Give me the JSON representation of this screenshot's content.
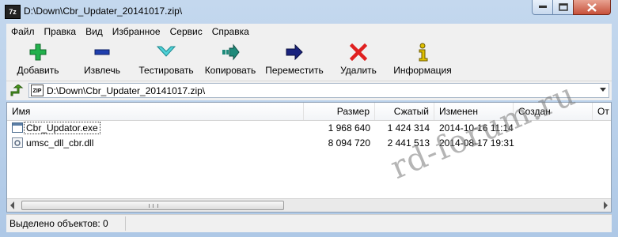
{
  "window": {
    "title": "D:\\Down\\Cbr_Updater_20141017.zip\\",
    "icon_text": "7z",
    "minimize_icon": "minimize-icon",
    "maximize_icon": "maximize-icon",
    "close_icon": "close-icon"
  },
  "menubar": {
    "items": [
      {
        "label": "Файл"
      },
      {
        "label": "Правка"
      },
      {
        "label": "Вид"
      },
      {
        "label": "Избранное"
      },
      {
        "label": "Сервис"
      },
      {
        "label": "Справка"
      }
    ]
  },
  "toolbar": {
    "buttons": [
      {
        "label": "Добавить",
        "icon": "plus-icon",
        "color": "#22b14c"
      },
      {
        "label": "Извлечь",
        "icon": "minus-icon",
        "color": "#1f3fae"
      },
      {
        "label": "Тестировать",
        "icon": "check-arrow-icon",
        "color": "#4fd0d6"
      },
      {
        "label": "Копировать",
        "icon": "copy-arrow-icon",
        "color": "#1e8a7a"
      },
      {
        "label": "Переместить",
        "icon": "move-arrow-icon",
        "color": "#1a237e"
      },
      {
        "label": "Удалить",
        "icon": "delete-x-icon",
        "color": "#e02020"
      },
      {
        "label": "Информация",
        "icon": "info-icon",
        "color": "#e0c000"
      }
    ]
  },
  "address": {
    "path": "D:\\Down\\Cbr_Updater_20141017.zip\\",
    "zip_icon_text": "ZIP"
  },
  "list": {
    "columns": [
      "Имя",
      "Размер",
      "Сжатый",
      "Изменен",
      "Создан",
      "От"
    ],
    "rows": [
      {
        "name": "Cbr_Updator.exe",
        "size": "1 968 640",
        "packed": "1 424 314",
        "modified": "2014-10-16 11:14",
        "created": "",
        "icon": "exe-file-icon"
      },
      {
        "name": "umsc_dll_cbr.dll",
        "size": "8 094 720",
        "packed": "2 441 513",
        "modified": "2014-08-17 19:31",
        "created": "",
        "icon": "dll-file-icon"
      }
    ]
  },
  "status": {
    "text": "Выделено объектов: 0"
  },
  "watermark": {
    "text": "rd-forum.ru"
  }
}
